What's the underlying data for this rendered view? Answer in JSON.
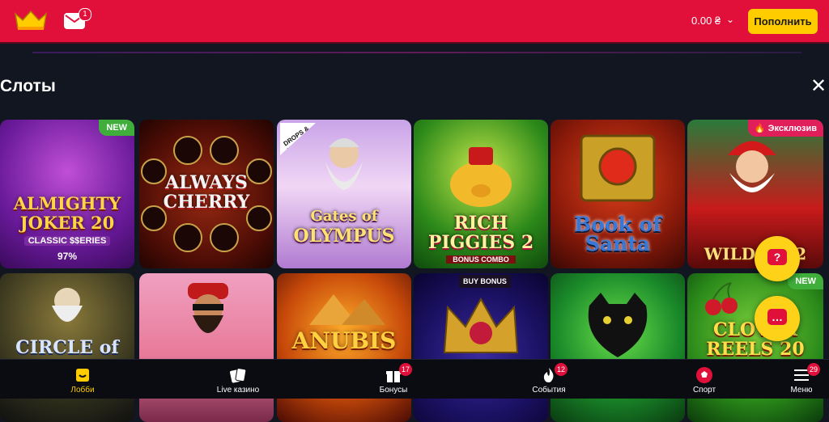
{
  "header": {
    "balance": "0.00 ₴",
    "deposit_label": "Пополнить",
    "mail_badge": "1",
    "accent_color": "#e0103b",
    "deposit_color": "#ffcc00"
  },
  "section": {
    "title": "Слоты"
  },
  "games": [
    {
      "title_line1": "ALMIGHTY",
      "title_line2": "JOKER 20",
      "subtitle": "CLASSIC $$ERIES",
      "badge": "NEW",
      "percent": "97%"
    },
    {
      "title_line1": "ALWAYS",
      "title_line2": "CHERRY"
    },
    {
      "title_line1": "Gates of",
      "title_line2": "OLYMPUS",
      "ribbon": "DROPS & WINS"
    },
    {
      "title_line1": "RICH",
      "title_line2": "PIGGIES 2",
      "subtitle": "BONUS COMBO"
    },
    {
      "title_line1": "Book of",
      "title_line2": "Santa"
    },
    {
      "title_line1": "WILD S",
      "title_line2": "2",
      "badge": "Эксклюзив"
    },
    {
      "title_line1": "CIRCLE",
      "title_line2": "of"
    },
    {
      "title_line1": "",
      "title_line2": ""
    },
    {
      "title_line1": "ANUBIS",
      "title_line2": ""
    },
    {
      "title_line1": "",
      "title_line2": "",
      "badge": "BUY BONUS"
    },
    {
      "title_line1": "",
      "title_line2": ""
    },
    {
      "title_line1": "CLOVER",
      "title_line2": "REELS 20",
      "badge": "NEW"
    }
  ],
  "fab": {
    "help_icon": "question-chat-icon",
    "chat_icon": "chat-bubble-icon",
    "help_glyph": "?"
  },
  "bottom_nav": [
    {
      "label": "Лобби",
      "icon": "lobby-icon",
      "active": true
    },
    {
      "label": "Live казино",
      "icon": "cards-icon"
    },
    {
      "label": "Бонусы",
      "icon": "gift-icon",
      "badge": "17"
    },
    {
      "label": "События",
      "icon": "flame-icon",
      "badge": "12"
    },
    {
      "label": "Спорт",
      "icon": "ball-icon"
    },
    {
      "label": "Меню",
      "icon": "menu-icon",
      "badge": "29"
    }
  ]
}
